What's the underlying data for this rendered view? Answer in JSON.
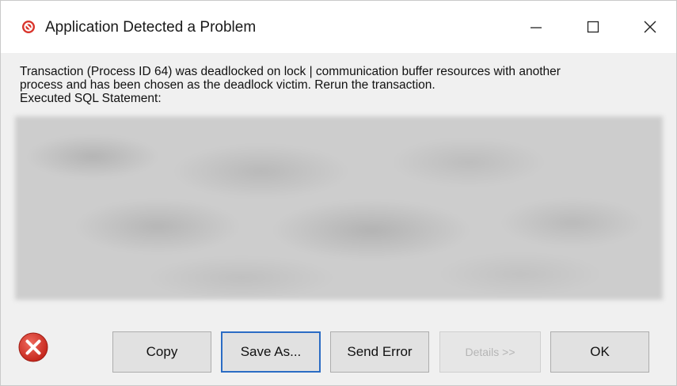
{
  "window": {
    "title": "Application Detected a Problem",
    "minimize_label": "Minimize",
    "maximize_label": "Maximize",
    "close_label": "Close"
  },
  "message": {
    "line1": "Transaction (Process ID 64) was deadlocked on lock | communication buffer resources with another",
    "line2": "process and has been chosen as the deadlock victim. Rerun the transaction.",
    "line3": "Executed SQL Statement:"
  },
  "icons": {
    "title_icon": "error-circle-icon",
    "error_icon": "error-x-icon"
  },
  "buttons": {
    "copy": "Copy",
    "save_as": "Save As...",
    "send_error": "Send Error",
    "details": "Details >>",
    "ok": "OK"
  },
  "colors": {
    "error_red": "#d9342b",
    "focus_blue": "#2b6cc4"
  }
}
